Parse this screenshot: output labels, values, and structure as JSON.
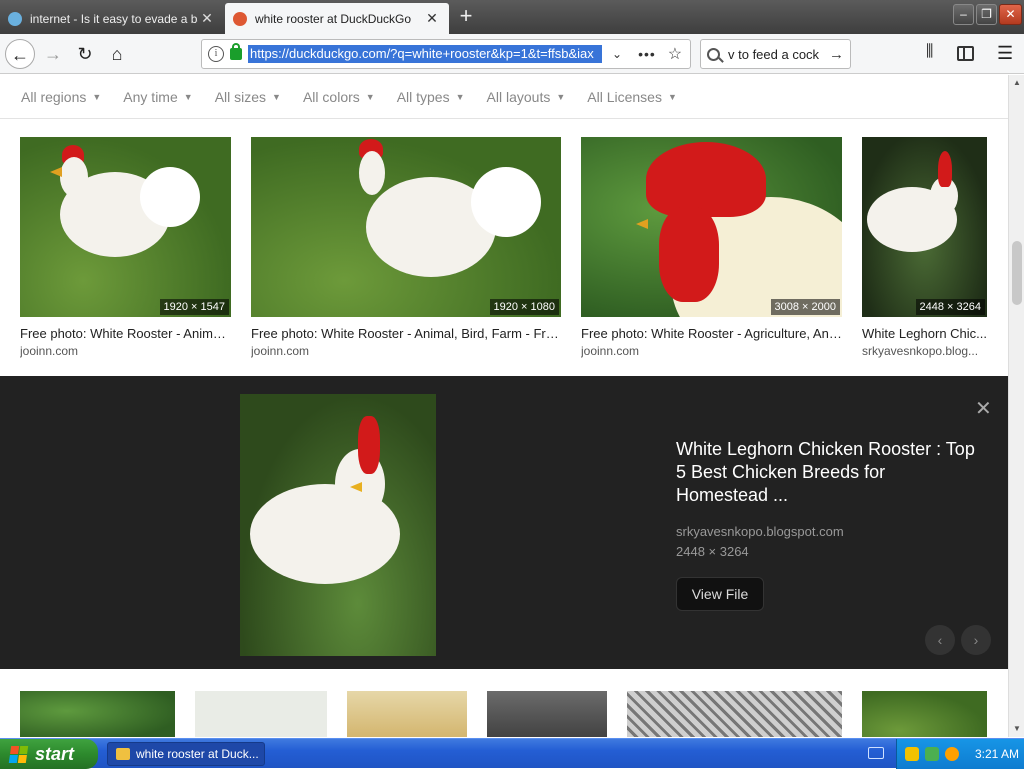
{
  "tabs": [
    {
      "title": "internet - Is it easy to evade a ba",
      "active": false
    },
    {
      "title": "white rooster at DuckDuckGo",
      "active": true
    }
  ],
  "window": {
    "minimize": "–",
    "restore": "❐",
    "close": "✕"
  },
  "nav": {
    "url": "https://duckduckgo.com/?q=white+rooster&kp=1&t=ffsb&iax",
    "search_value": "v to feed a cock"
  },
  "filters": [
    "All regions",
    "Any time",
    "All sizes",
    "All colors",
    "All types",
    "All layouts",
    "All Licenses"
  ],
  "results": [
    {
      "caption": "Free photo: White Rooster - Animal,...",
      "source": "jooinn.com",
      "dims": "1920 × 1547"
    },
    {
      "caption": "Free photo: White Rooster - Animal, Bird, Farm - Free...",
      "source": "jooinn.com",
      "dims": "1920 × 1080"
    },
    {
      "caption": "Free photo: White Rooster - Agriculture, Ani...",
      "source": "jooinn.com",
      "dims": "3008 × 2000"
    },
    {
      "caption": "White Leghorn Chic...",
      "source": "srkyavesnkopo.blog...",
      "dims": "2448 × 3264"
    }
  ],
  "detail": {
    "title": "White Leghorn Chicken Rooster : Top 5 Best Chicken Breeds for Homestead ...",
    "source": "srkyavesnkopo.blogspot.com",
    "dims": "2448 × 3264",
    "view_label": "View File"
  },
  "taskbar": {
    "start_label": "start",
    "window_item": "white rooster at Duck...",
    "clock": "3:21 AM"
  },
  "colors": {
    "accent_url": "#3874d8",
    "start_green": "#2d8a2d",
    "taskbar_blue": "#245ed4",
    "detail_bg": "#222222",
    "comb_red": "#d21a1a"
  }
}
